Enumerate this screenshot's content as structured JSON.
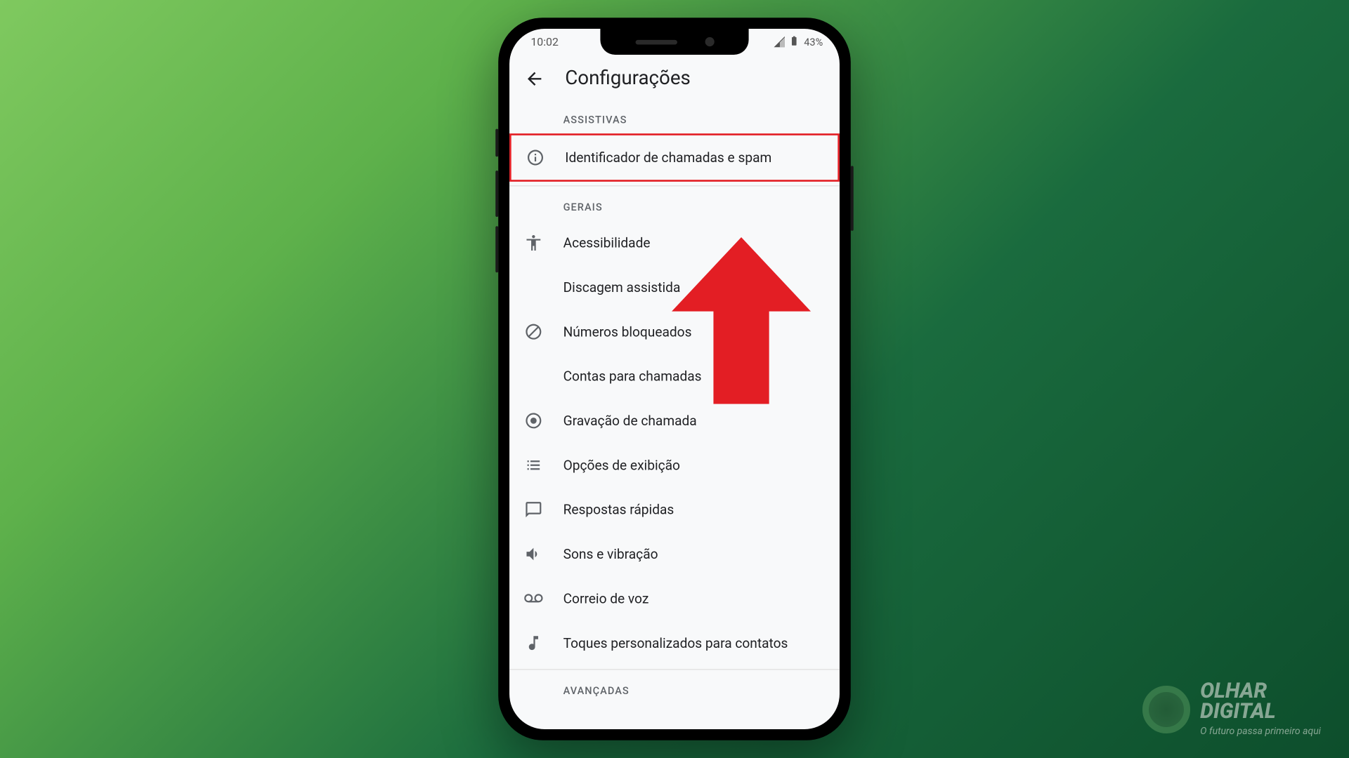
{
  "status_bar": {
    "time": "10:02",
    "battery": "43%"
  },
  "header": {
    "title": "Configurações"
  },
  "sections": {
    "assistivas": {
      "label": "ASSISTIVAS",
      "items": {
        "caller_id": "Identificador de chamadas e spam"
      }
    },
    "gerais": {
      "label": "GERAIS",
      "items": {
        "accessibility": "Acessibilidade",
        "assisted_dialing": "Discagem assistida",
        "blocked_numbers": "Números bloqueados",
        "call_accounts": "Contas para chamadas",
        "call_recording": "Gravação de chamada",
        "display_options": "Opções de exibição",
        "quick_responses": "Respostas rápidas",
        "sounds_vibration": "Sons e vibração",
        "voicemail": "Correio de voz",
        "custom_ringtones": "Toques personalizados para contatos"
      }
    },
    "avancadas": {
      "label": "AVANÇADAS"
    }
  },
  "brand": {
    "name_line1": "OLHAR",
    "name_line2": "DIGITAL",
    "tagline": "O futuro passa primeiro aqui"
  }
}
